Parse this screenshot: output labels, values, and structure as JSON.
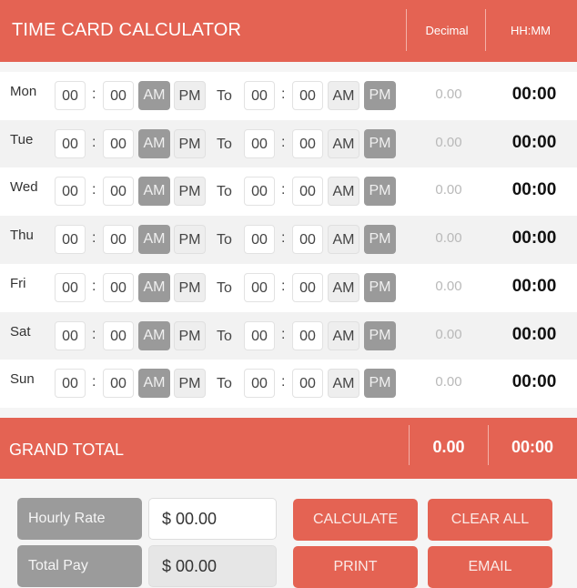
{
  "header": {
    "title": "TIME CARD CALCULATOR",
    "decimal_label": "Decimal",
    "hhmm_label": "HH:MM"
  },
  "rows": [
    {
      "day": "Mon",
      "start_h": "00",
      "start_m": "00",
      "start_am": "AM",
      "start_pm": "PM",
      "to": "To",
      "end_h": "00",
      "end_m": "00",
      "end_am": "AM",
      "end_pm": "PM",
      "decimal": "0.00",
      "hhmm": "00:00"
    },
    {
      "day": "Tue",
      "start_h": "00",
      "start_m": "00",
      "start_am": "AM",
      "start_pm": "PM",
      "to": "To",
      "end_h": "00",
      "end_m": "00",
      "end_am": "AM",
      "end_pm": "PM",
      "decimal": "0.00",
      "hhmm": "00:00"
    },
    {
      "day": "Wed",
      "start_h": "00",
      "start_m": "00",
      "start_am": "AM",
      "start_pm": "PM",
      "to": "To",
      "end_h": "00",
      "end_m": "00",
      "end_am": "AM",
      "end_pm": "PM",
      "decimal": "0.00",
      "hhmm": "00:00"
    },
    {
      "day": "Thu",
      "start_h": "00",
      "start_m": "00",
      "start_am": "AM",
      "start_pm": "PM",
      "to": "To",
      "end_h": "00",
      "end_m": "00",
      "end_am": "AM",
      "end_pm": "PM",
      "decimal": "0.00",
      "hhmm": "00:00"
    },
    {
      "day": "Fri",
      "start_h": "00",
      "start_m": "00",
      "start_am": "AM",
      "start_pm": "PM",
      "to": "To",
      "end_h": "00",
      "end_m": "00",
      "end_am": "AM",
      "end_pm": "PM",
      "decimal": "0.00",
      "hhmm": "00:00"
    },
    {
      "day": "Sat",
      "start_h": "00",
      "start_m": "00",
      "start_am": "AM",
      "start_pm": "PM",
      "to": "To",
      "end_h": "00",
      "end_m": "00",
      "end_am": "AM",
      "end_pm": "PM",
      "decimal": "0.00",
      "hhmm": "00:00"
    },
    {
      "day": "Sun",
      "start_h": "00",
      "start_m": "00",
      "start_am": "AM",
      "start_pm": "PM",
      "to": "To",
      "end_h": "00",
      "end_m": "00",
      "end_am": "AM",
      "end_pm": "PM",
      "decimal": "0.00",
      "hhmm": "00:00"
    }
  ],
  "grand_total": {
    "label": "GRAND TOTAL",
    "decimal": "0.00",
    "hhmm": "00:00"
  },
  "footer": {
    "hourly_rate_label": "Hourly Rate",
    "hourly_rate_value": "$ 00.00",
    "total_pay_label": "Total Pay",
    "total_pay_value": "$ 00.00",
    "calculate": "CALCULATE",
    "clear_all": "CLEAR ALL",
    "print": "PRINT",
    "email": "EMAIL"
  },
  "colors": {
    "accent": "#e46353",
    "selected": "#9a9a9a"
  }
}
